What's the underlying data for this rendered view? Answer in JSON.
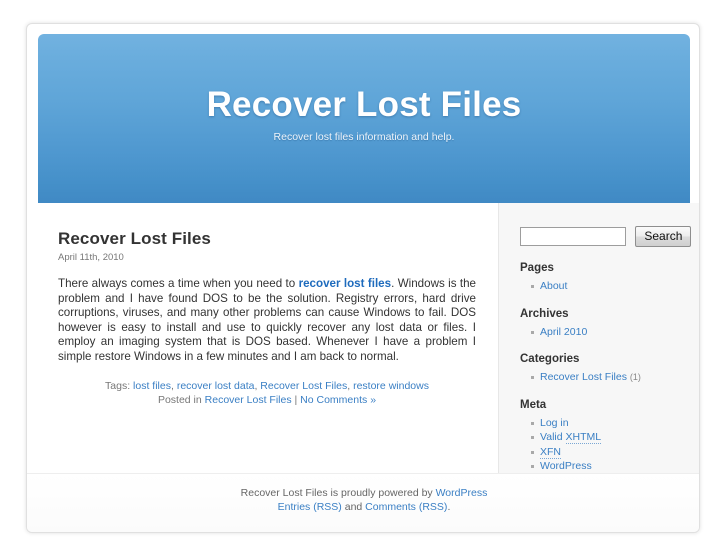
{
  "header": {
    "blog_title": "Recover Lost Files",
    "blog_description": "Recover lost files information and help."
  },
  "post": {
    "title": "Recover Lost Files",
    "date": "April 11th, 2010",
    "body_before_link": "There always comes a time when you need to ",
    "body_link": "recover lost files",
    "body_after_link": ".  Windows is the problem and I have found DOS to be the solution.  Registry errors, hard drive corruptions, viruses, and many other problems can cause Windows to fail.  DOS however is easy to install and use to quickly recover any lost data or files.  I employ an imaging system that is DOS based.  Whenever I have a problem I simple restore Windows in a few minutes and I am back to normal.",
    "tags_label": "Tags: ",
    "tags": [
      "lost files",
      "recover lost data",
      "Recover Lost Files",
      "restore windows"
    ],
    "tags_separator": ", ",
    "posted_in_label": "Posted in ",
    "category": "Recover Lost Files",
    "meta_separator": " | ",
    "comments_link": "No Comments »"
  },
  "sidebar": {
    "search": {
      "value": "",
      "placeholder": "",
      "button_label": "Search"
    },
    "widgets": [
      {
        "title": "Pages",
        "items": [
          {
            "label": "About",
            "count": "",
            "abbr": false
          }
        ]
      },
      {
        "title": "Archives",
        "items": [
          {
            "label": "April 2010",
            "count": "",
            "abbr": false
          }
        ]
      },
      {
        "title": "Categories",
        "items": [
          {
            "label": "Recover Lost Files",
            "count": "(1)",
            "abbr": false
          }
        ]
      },
      {
        "title": "Meta",
        "items": [
          {
            "label": "Log in",
            "count": "",
            "abbr": false
          },
          {
            "label": "Valid XHTML",
            "count": "",
            "abbr": true,
            "abbr_part": "XHTML",
            "plain_part": "Valid "
          },
          {
            "label": "XFN",
            "count": "",
            "abbr": true,
            "abbr_part": "XFN",
            "plain_part": ""
          },
          {
            "label": "WordPress",
            "count": "",
            "abbr": false
          }
        ]
      }
    ]
  },
  "footer": {
    "line1_prefix": "Recover Lost Files is proudly powered by ",
    "line1_link": "WordPress",
    "line2_link1": "Entries (RSS)",
    "line2_middle": " and ",
    "line2_link2": "Comments (RSS)",
    "line2_suffix": "."
  },
  "colors": {
    "header_blue_top": "#72b2e0",
    "header_blue_bottom": "#4089c4",
    "link_blue": "#3a7fc4",
    "strong_link_blue": "#1e6bbd",
    "sidebar_bg": "#f7f7f7",
    "text": "#333333",
    "muted_text": "#777777"
  }
}
